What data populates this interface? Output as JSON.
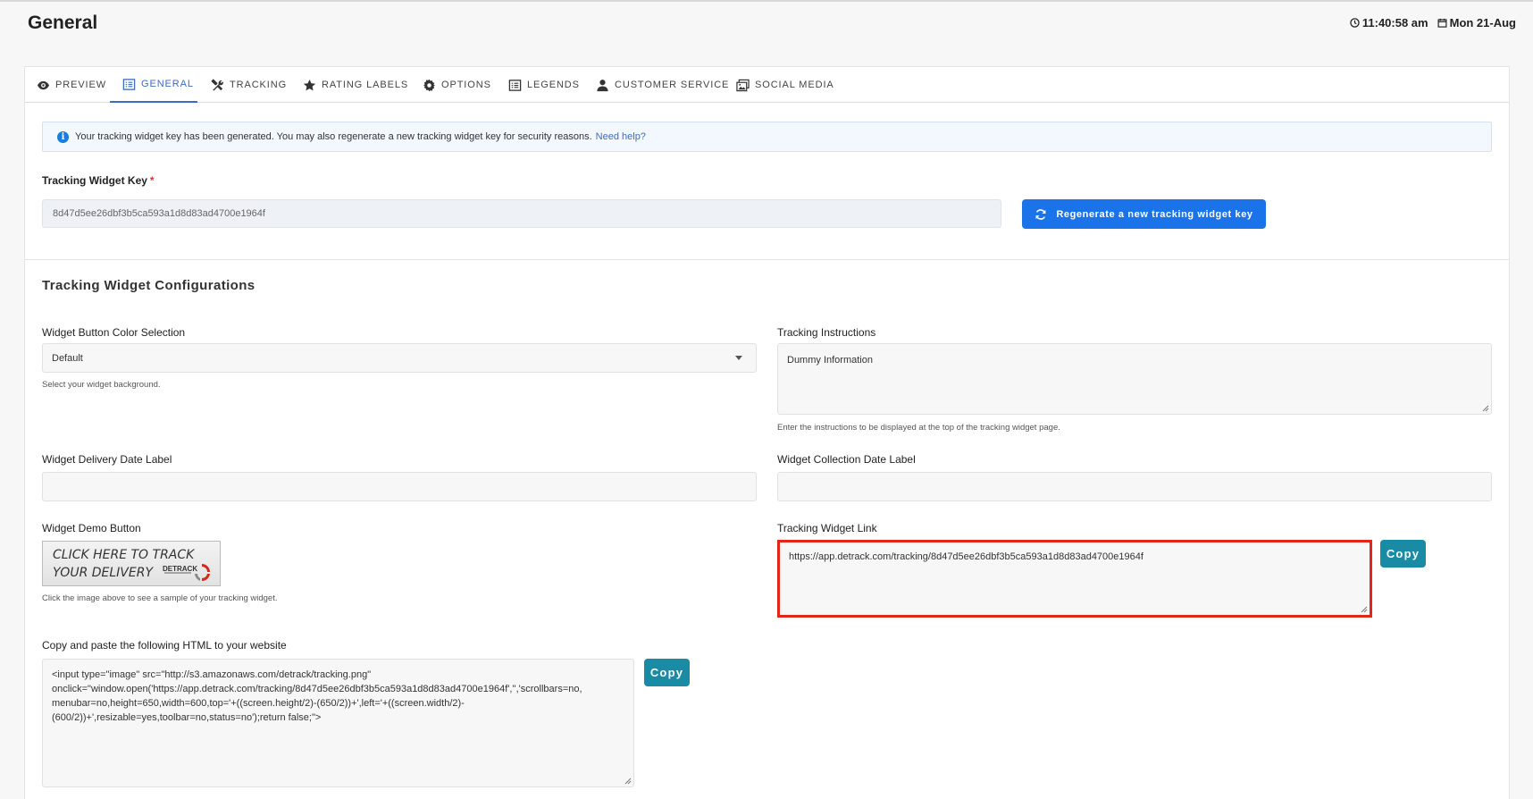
{
  "header": {
    "title": "General",
    "time": "11:40:58 am",
    "date": "Mon 21-Aug"
  },
  "tabs": [
    {
      "label": "PREVIEW",
      "icon": "eye-icon"
    },
    {
      "label": "GENERAL",
      "icon": "list-icon",
      "active": true
    },
    {
      "label": "TRACKING",
      "icon": "tools-icon"
    },
    {
      "label": "RATING LABELS",
      "icon": "star-icon"
    },
    {
      "label": "OPTIONS",
      "icon": "gear-icon"
    },
    {
      "label": "LEGENDS",
      "icon": "list-icon"
    },
    {
      "label": "CUSTOMER SERVICE",
      "icon": "user-icon"
    },
    {
      "label": "SOCIAL MEDIA",
      "icon": "images-icon"
    }
  ],
  "alert": {
    "text": "Your tracking widget key has been generated. You may also regenerate a new tracking widget key for security reasons.",
    "link": "Need help?"
  },
  "key": {
    "label": "Tracking Widget Key",
    "required_mark": "*",
    "value": "8d47d5ee26dbf3b5ca593a1d8d83ad4700e1964f",
    "regenerate_label": "Regenerate a new tracking widget key"
  },
  "config": {
    "title": "Tracking Widget Configurations",
    "button_color": {
      "label": "Widget Button Color Selection",
      "value": "Default",
      "help": "Select your widget background."
    },
    "instructions": {
      "label": "Tracking Instructions",
      "value": "Dummy Information",
      "help": "Enter the instructions to be displayed at the top of the tracking widget page."
    },
    "delivery_date": {
      "label": "Widget Delivery Date Label",
      "value": ""
    },
    "collection_date": {
      "label": "Widget Collection Date Label",
      "value": ""
    },
    "demo_button": {
      "label": "Widget Demo Button",
      "line1": "CLICK HERE TO TRACK",
      "line2": "YOUR DELIVERY",
      "logo_text": "DETRACK",
      "help": "Click the image above to see a sample of your tracking widget."
    },
    "widget_link": {
      "label": "Tracking Widget Link",
      "value": "https://app.detrack.com/tracking/8d47d5ee26dbf3b5ca593a1d8d83ad4700e1964f",
      "copy_label": "Copy"
    },
    "html_code": {
      "label": "Copy and paste the following HTML to your website",
      "value": "<input type=\"image\" src=\"http://s3.amazonaws.com/detrack/tracking.png\"\nonclick=\"window.open('https://app.detrack.com/tracking/8d47d5ee26dbf3b5ca593a1d8d83ad4700e1964f','','scrollbars=no,\nmenubar=no,height=650,width=600,top='+((screen.height/2)-(650/2))+',left='+((screen.width/2)-\n(600/2))+',resizable=yes,toolbar=no,status=no');return false;\">",
      "copy_label": "Copy"
    }
  }
}
